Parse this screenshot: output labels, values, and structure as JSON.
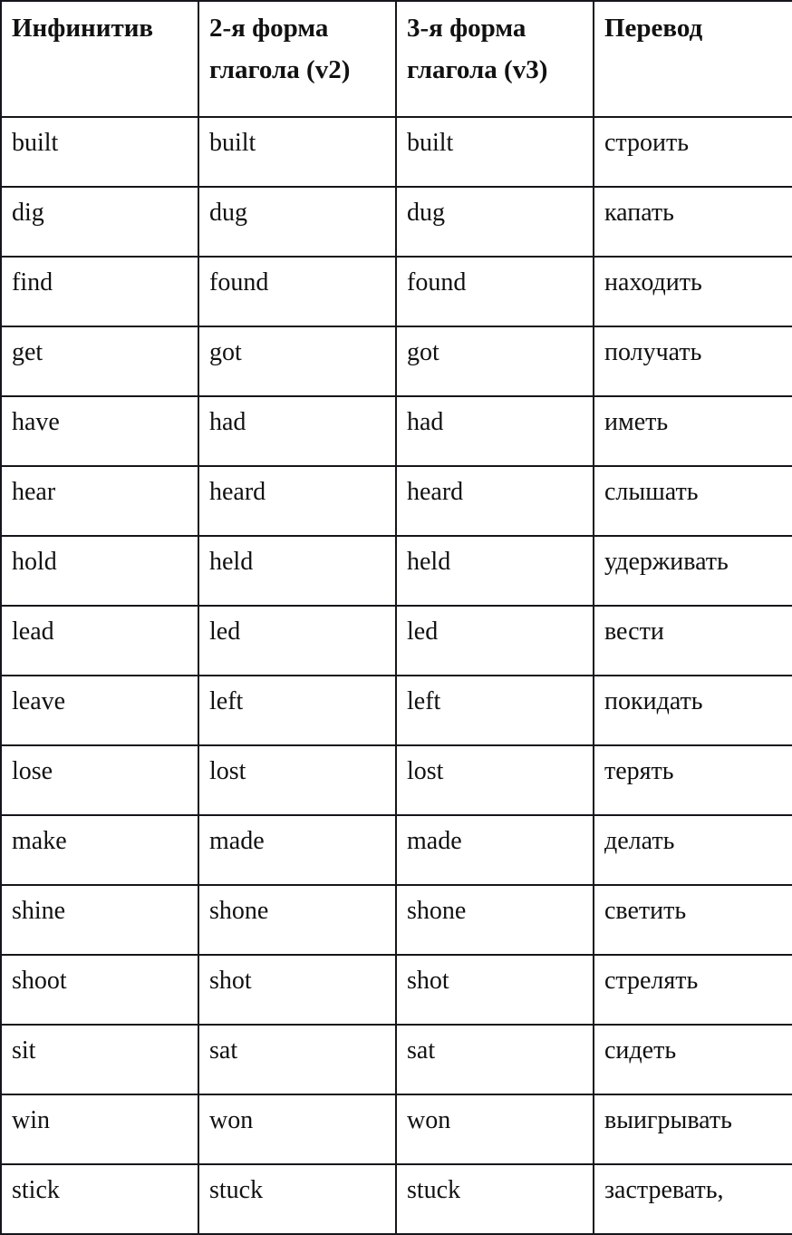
{
  "table": {
    "headers": [
      {
        "line1": "Инфинитив",
        "line2": ""
      },
      {
        "line1": "2-я форма",
        "line2": "глагола (v2)"
      },
      {
        "line1": "3-я форма",
        "line2": "глагола (v3)"
      },
      {
        "line1": "Перевод",
        "line2": ""
      }
    ],
    "column_names": [
      "Инфинитив",
      "2-я форма глагола (v2)",
      "3-я форма глагола (v3)",
      "Перевод"
    ],
    "rows": [
      {
        "infinitive": "built",
        "v2": "built",
        "v3": "built",
        "translation": "строить"
      },
      {
        "infinitive": "dig",
        "v2": "dug",
        "v3": "dug",
        "translation": "капать"
      },
      {
        "infinitive": "find",
        "v2": "found",
        "v3": "found",
        "translation": "находить"
      },
      {
        "infinitive": "get",
        "v2": "got",
        "v3": "got",
        "translation": "получать"
      },
      {
        "infinitive": "have",
        "v2": "had",
        "v3": "had",
        "translation": "иметь"
      },
      {
        "infinitive": "hear",
        "v2": "heard",
        "v3": "heard",
        "translation": "слышать"
      },
      {
        "infinitive": "hold",
        "v2": "held",
        "v3": "held",
        "translation": "удерживать"
      },
      {
        "infinitive": "lead",
        "v2": "led",
        "v3": "led",
        "translation": "вести"
      },
      {
        "infinitive": "leave",
        "v2": "left",
        "v3": "left",
        "translation": "покидать"
      },
      {
        "infinitive": "lose",
        "v2": "lost",
        "v3": "lost",
        "translation": "терять"
      },
      {
        "infinitive": "make",
        "v2": "made",
        "v3": "made",
        "translation": "делать"
      },
      {
        "infinitive": "shine",
        "v2": "shone",
        "v3": "shone",
        "translation": "светить"
      },
      {
        "infinitive": "shoot",
        "v2": "shot",
        "v3": "shot",
        "translation": "стрелять"
      },
      {
        "infinitive": "sit",
        "v2": "sat",
        "v3": "sat",
        "translation": "сидеть"
      },
      {
        "infinitive": "win",
        "v2": "won",
        "v3": "won",
        "translation": "выигрывать"
      },
      {
        "infinitive": "stick",
        "v2": "stuck",
        "v3": "stuck",
        "translation": "застревать,"
      }
    ],
    "colors": {
      "border": "#15161c",
      "background": "#ffffff",
      "text": "#111111"
    }
  }
}
